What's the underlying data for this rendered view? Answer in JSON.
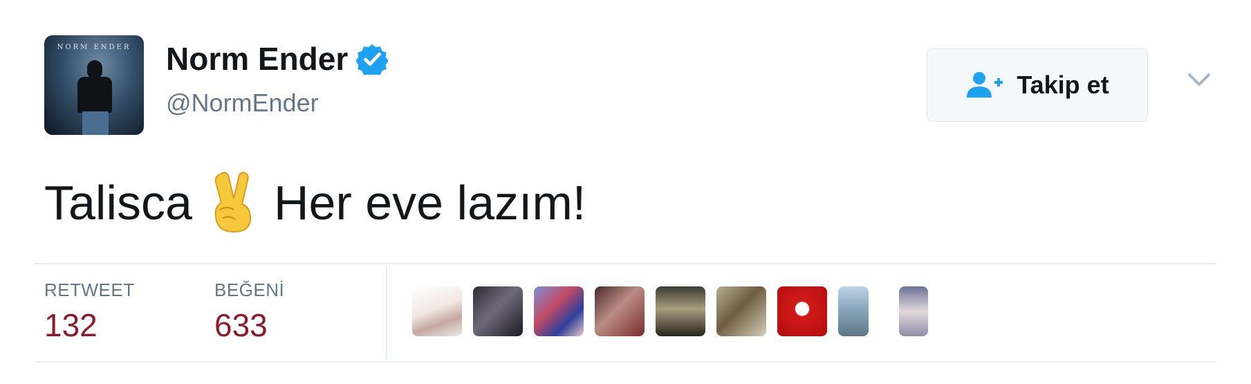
{
  "tweet": {
    "author": {
      "display_name": "Norm Ender",
      "handle": "@NormEnder",
      "verified": true,
      "avatar_text": "NORM ENDER"
    },
    "follow_button": {
      "label": "Takip et",
      "icon": "add-user-icon"
    },
    "menu_icon": "chevron-down-icon",
    "text_before_emoji": "Talisca",
    "emoji": "victory-hand-emoji",
    "text_after_emoji": "Her eve lazım!",
    "stats": {
      "retweet_label": "RETWEET",
      "retweet_count": "132",
      "likes_label": "BEĞENİ",
      "likes_count": "633"
    },
    "liker_count_shown": 9
  },
  "colors": {
    "verified_blue": "#1da1f2",
    "follow_icon_blue": "#1da1f2",
    "stat_count": "#8c1c2b",
    "secondary_text": "#657786",
    "divider": "#e6ecf0"
  }
}
